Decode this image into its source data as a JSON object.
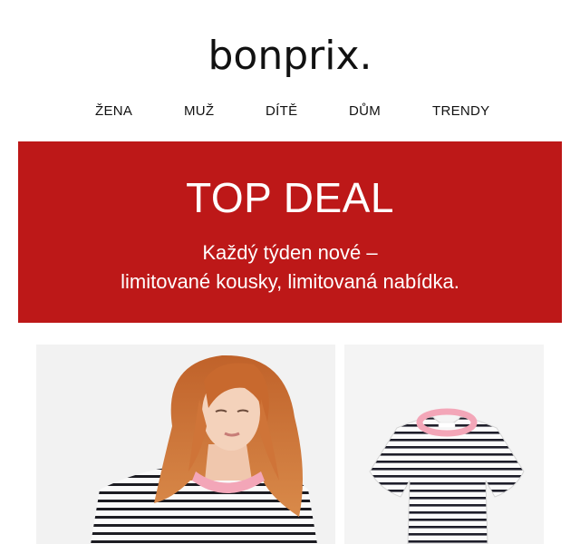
{
  "brand": {
    "logo_text": "bonprix."
  },
  "nav": {
    "items": [
      {
        "label": "ŽENA"
      },
      {
        "label": "MUŽ"
      },
      {
        "label": "DÍTĚ"
      },
      {
        "label": "DŮM"
      },
      {
        "label": "TRENDY"
      }
    ]
  },
  "banner": {
    "title": "TOP DEAL",
    "line1": "Každý týden nové –",
    "line2": "limitované kousky, limitovaná nabídka.",
    "color": "#bd1818"
  },
  "products": {
    "model_photo": {
      "icon": "model-photo"
    },
    "tshirt_photo": {
      "icon": "striped-tshirt"
    }
  }
}
